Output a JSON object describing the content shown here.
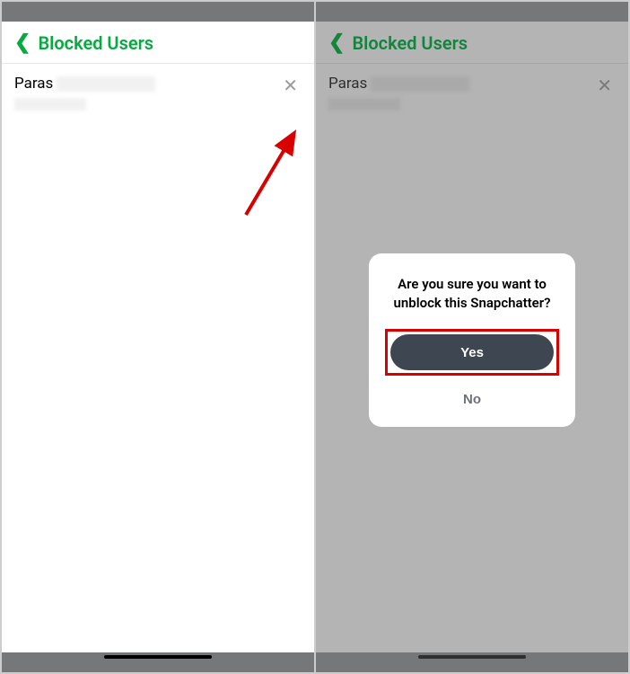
{
  "left": {
    "header": {
      "title": "Blocked Users"
    },
    "user": {
      "name": "Paras"
    }
  },
  "right": {
    "header": {
      "title": "Blocked Users"
    },
    "user": {
      "name": "Paras"
    },
    "dialog": {
      "message": "Are you sure you want to unblock this Snapchatter?",
      "yes": "Yes",
      "no": "No"
    }
  }
}
